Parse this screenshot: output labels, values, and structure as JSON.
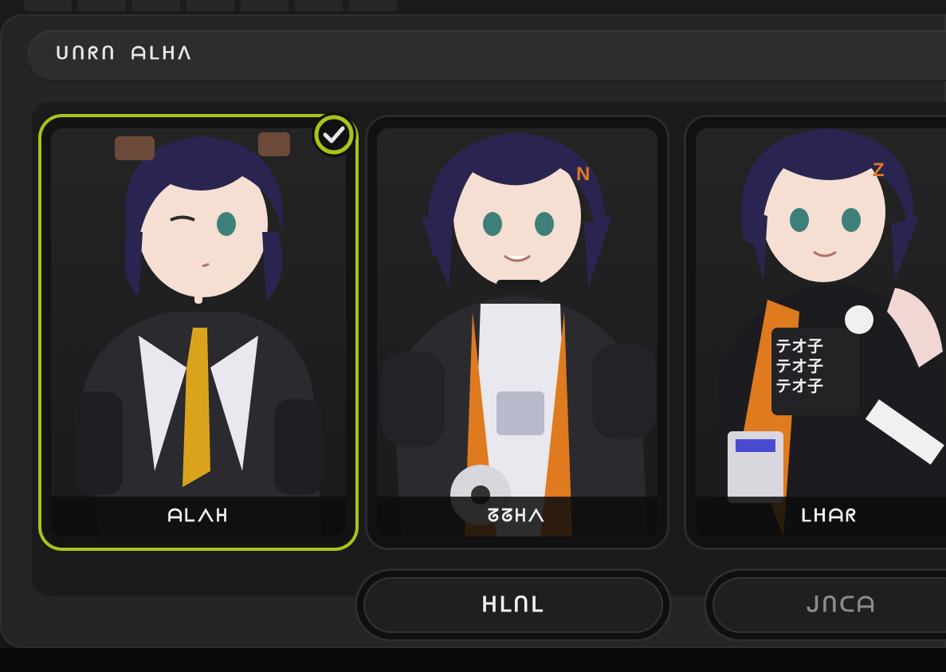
{
  "header": {
    "title": "ᑌᑎᖇᑎ ᗩᒪᕼᐱ"
  },
  "cards": [
    {
      "name": "ᗩᒪᐱᕼ",
      "selected": true
    },
    {
      "name": "ᘔᘔᕼᐱ",
      "selected": false
    },
    {
      "name": "ᒪᕼᗩᖇ",
      "selected": false
    }
  ],
  "buttons": {
    "confirm": "ᕼᒪᑎᒪ",
    "cancel": "ᒍᑎᑕᗩ"
  },
  "colors": {
    "accent": "#a9c418",
    "panel": "#252526",
    "background": "#111112",
    "hair": "#2a2550",
    "tie": "#d9a41c",
    "orange": "#e07a1f"
  },
  "icons": {
    "selected": "check-circle-icon"
  }
}
